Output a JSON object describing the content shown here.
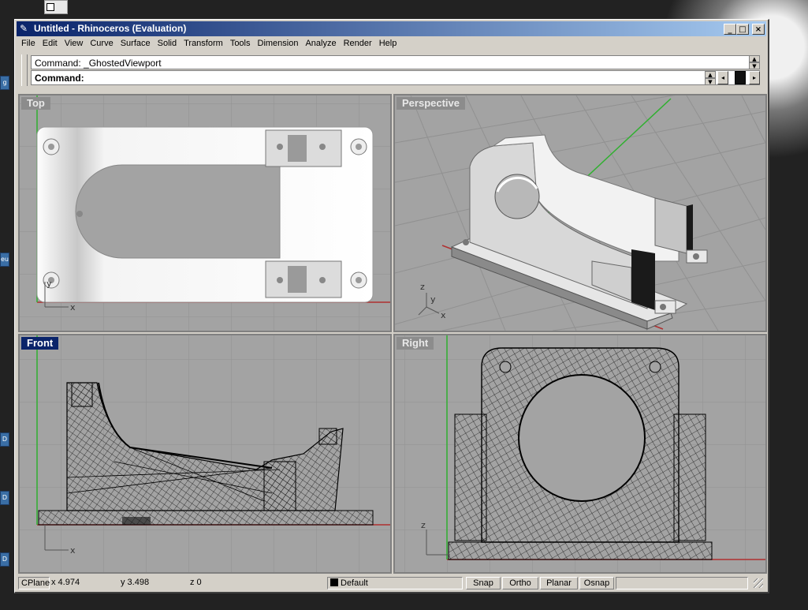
{
  "window": {
    "title": "Untitled - Rhinoceros (Evaluation)",
    "app_icon": "rhino-icon"
  },
  "menu": [
    "File",
    "Edit",
    "View",
    "Curve",
    "Surface",
    "Solid",
    "Transform",
    "Tools",
    "Dimension",
    "Analyze",
    "Render",
    "Help"
  ],
  "command": {
    "history": "Command: _GhostedViewport",
    "prompt": "Command:"
  },
  "viewports": {
    "top": "Top",
    "perspective": "Perspective",
    "front": "Front",
    "right": "Right",
    "active": "Front"
  },
  "axes": {
    "x": "x",
    "y": "y",
    "z": "z"
  },
  "status": {
    "cplane": "CPlane",
    "x": "x 4.974",
    "y": "y 3.498",
    "z": "z 0",
    "layer": "Default",
    "snap": "Snap",
    "ortho": "Ortho",
    "planar": "Planar",
    "osnap": "Osnap"
  },
  "colors": {
    "viewport_bg": "#a3a3a3",
    "grid": "#8f8f8f",
    "x_axis": "#b03030",
    "y_axis": "#30b030",
    "active_label": "#0a246a",
    "title_bar": "#0a246a"
  },
  "desktop_tabs": [
    "g",
    "eu",
    "D",
    "D",
    "D"
  ]
}
